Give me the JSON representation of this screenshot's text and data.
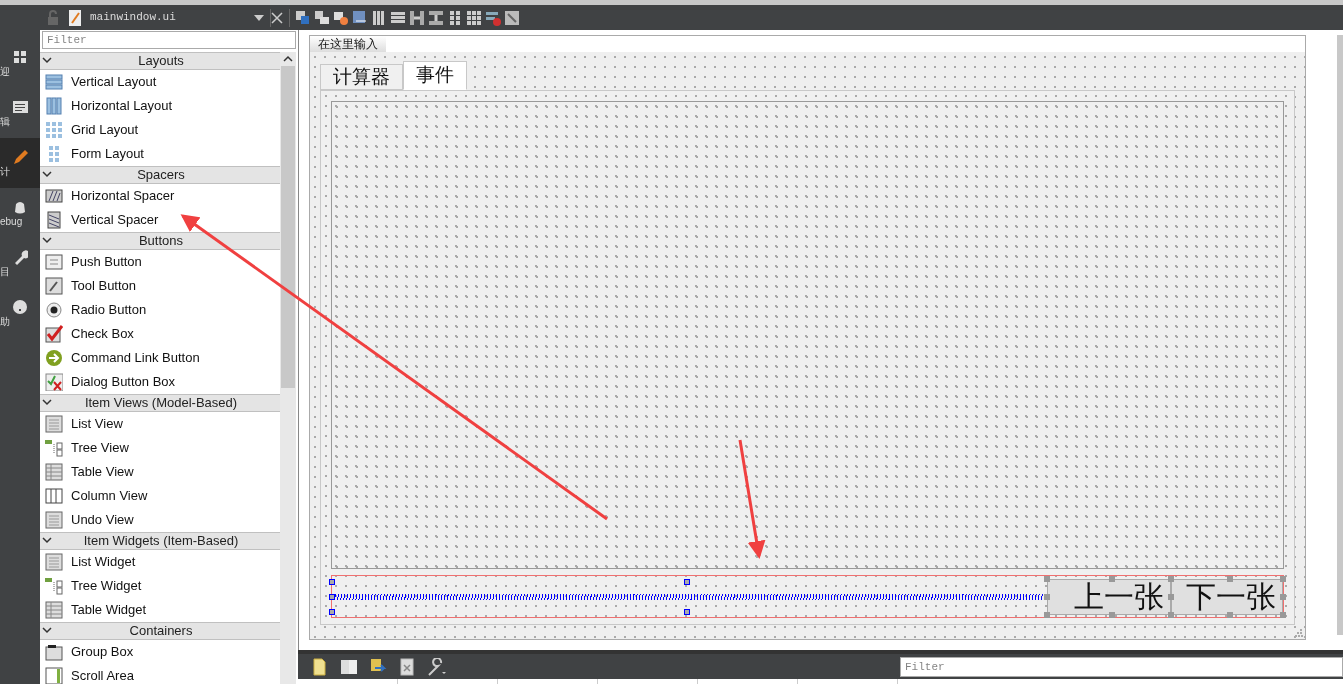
{
  "mode_bar": {
    "items": [
      {
        "label": "迎",
        "selected": false
      },
      {
        "label": "辑",
        "selected": false
      },
      {
        "label": "计",
        "selected": true
      },
      {
        "label": "ebug",
        "selected": false
      },
      {
        "label": "目",
        "selected": false
      },
      {
        "label": "助",
        "selected": false
      }
    ]
  },
  "editor_tab": {
    "file": "mainwindow.ui"
  },
  "widget_box": {
    "filter": {
      "placeholder": "Filter"
    },
    "categories": [
      {
        "title": "Layouts",
        "expanded": true,
        "items": [
          "Vertical Layout",
          "Horizontal Layout",
          "Grid Layout",
          "Form Layout"
        ]
      },
      {
        "title": "Spacers",
        "expanded": true,
        "items": [
          "Horizontal Spacer",
          "Vertical Spacer"
        ]
      },
      {
        "title": "Buttons",
        "expanded": true,
        "items": [
          "Push Button",
          "Tool Button",
          "Radio Button",
          "Check Box",
          "Command Link Button",
          "Dialog Button Box"
        ]
      },
      {
        "title": "Item Views (Model-Based)",
        "expanded": true,
        "items": [
          "List View",
          "Tree View",
          "Table View",
          "Column View",
          "Undo View"
        ]
      },
      {
        "title": "Item Widgets (Item-Based)",
        "expanded": true,
        "items": [
          "List Widget",
          "Tree Widget",
          "Table Widget"
        ]
      },
      {
        "title": "Containers",
        "expanded": true,
        "items": [
          "Group Box",
          "Scroll Area"
        ]
      }
    ]
  },
  "form": {
    "menu_placeholder": "在这里输入",
    "tabs": [
      {
        "label": "计算器",
        "selected": false
      },
      {
        "label": "事件",
        "selected": true
      }
    ],
    "spacer": {
      "selected": true
    },
    "buttons": [
      "上一张",
      "下一张"
    ]
  },
  "action_editor": {
    "filter": {
      "placeholder": "Filter"
    }
  }
}
